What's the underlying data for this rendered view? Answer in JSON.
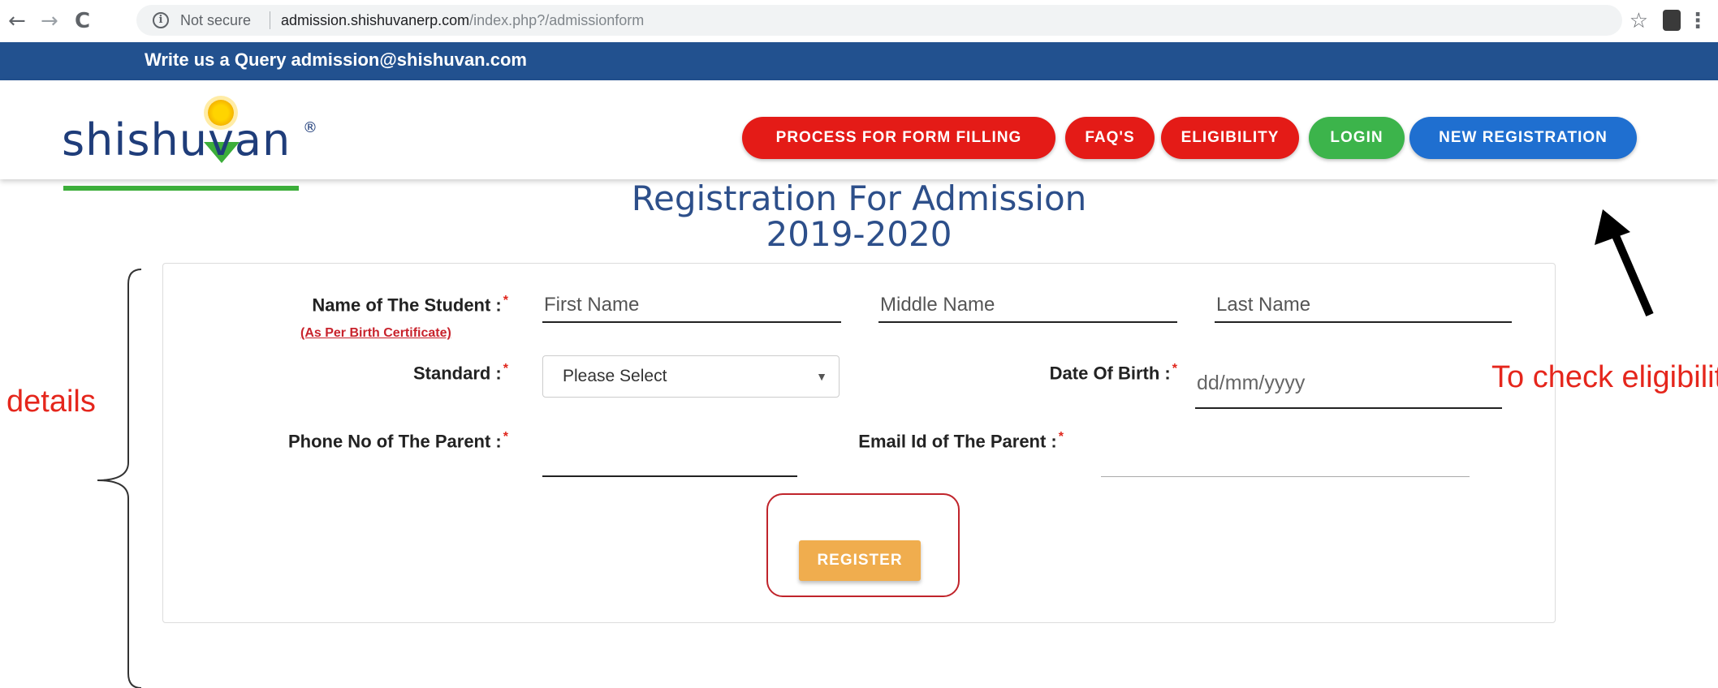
{
  "browser": {
    "back": "←",
    "forward": "→",
    "reload": "C",
    "security_label": "Not secure",
    "url_host": "admission.shishuvanerp.com",
    "url_path": "/index.php?/admissionform",
    "star": "☆",
    "menu": "⋮"
  },
  "topbar": {
    "query_text": "Write us a Query admission@shishuvan.com"
  },
  "logo": {
    "text": "shishuvan",
    "registered": "®"
  },
  "nav": {
    "process": "PROCESS FOR FORM FILLING",
    "faqs": "FAQ'S",
    "eligibility": "ELIGIBILITY",
    "login": "LOGIN",
    "new_registration": "NEW REGISTRATION"
  },
  "page": {
    "title_line1": "Registration For Admission",
    "title_line2": "2019-2020"
  },
  "form": {
    "student_name_label": "Name of The Student :",
    "student_name_hint": "(As Per Birth Certificate)",
    "first_name_placeholder": "First Name",
    "middle_name_placeholder": "Middle Name",
    "last_name_placeholder": "Last Name",
    "standard_label": "Standard :",
    "standard_value": "Please Select",
    "dob_label": "Date Of Birth :",
    "dob_placeholder": "dd/mm/yyyy",
    "phone_label": "Phone No of The Parent :",
    "email_label": "Email Id of The Parent :",
    "required_mark": "*",
    "register_button": "REGISTER"
  },
  "annotations": {
    "details": "details",
    "eligibility_note": "To check eligibilit"
  },
  "colors": {
    "topbar": "#22518f",
    "pill_red": "#e41b17",
    "pill_green": "#3cb44b",
    "pill_blue": "#1f6fd0",
    "register": "#f0ad4e",
    "annotation_red": "#e5261c"
  }
}
